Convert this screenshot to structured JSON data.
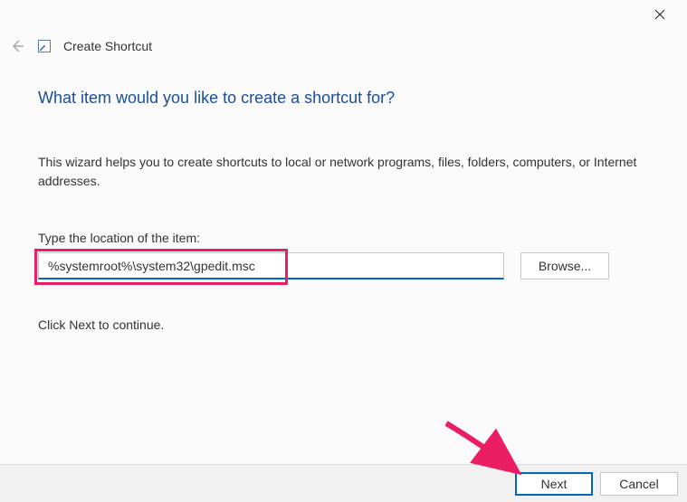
{
  "window": {
    "title": "Create Shortcut"
  },
  "main": {
    "heading": "What item would you like to create a shortcut for?",
    "description": "This wizard helps you to create shortcuts to local or network programs, files, folders, computers, or Internet addresses.",
    "field_label": "Type the location of the item:",
    "location_value": "%systemroot%\\system32\\gpedit.msc",
    "browse_label": "Browse...",
    "hint": "Click Next to continue."
  },
  "footer": {
    "next_label": "Next",
    "cancel_label": "Cancel"
  },
  "colors": {
    "accent": "#0067c0",
    "highlight": "#e91e63",
    "heading": "#1a4fa0"
  }
}
